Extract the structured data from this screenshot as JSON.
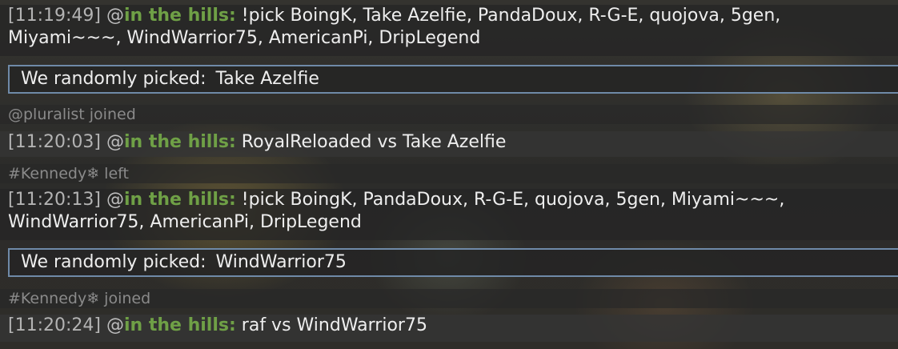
{
  "messages": [
    {
      "time": "[11:19:49]",
      "user": "in the hills:",
      "text": "!pick BoingK, Take Azelfie, PandaDoux, R-G-E, quojova, 5gen,",
      "text2": "Miyami~~~, WindWarrior75, AmericanPi, DripLegend"
    },
    {
      "time": "[11:20:03]",
      "user": "in the hills:",
      "text": "RoyalReloaded vs Take Azelfie"
    },
    {
      "time": "[11:20:13]",
      "user": "in the hills:",
      "text": "!pick BoingK, PandaDoux, R-G-E, quojova, 5gen, Miyami~~~,",
      "text2": "WindWarrior75, AmericanPi, DripLegend"
    },
    {
      "time": "[11:20:24]",
      "user": "in the hills:",
      "text": "raf vs WindWarrior75"
    }
  ],
  "at_sign": "@",
  "picks": [
    {
      "label": "We randomly picked:",
      "value": "Take Azelfie"
    },
    {
      "label": "We randomly picked:",
      "value": "WindWarrior75"
    }
  ],
  "status_lines": [
    "@pluralist joined",
    "#Kennedy❄ left",
    "#Kennedy❄ joined"
  ]
}
